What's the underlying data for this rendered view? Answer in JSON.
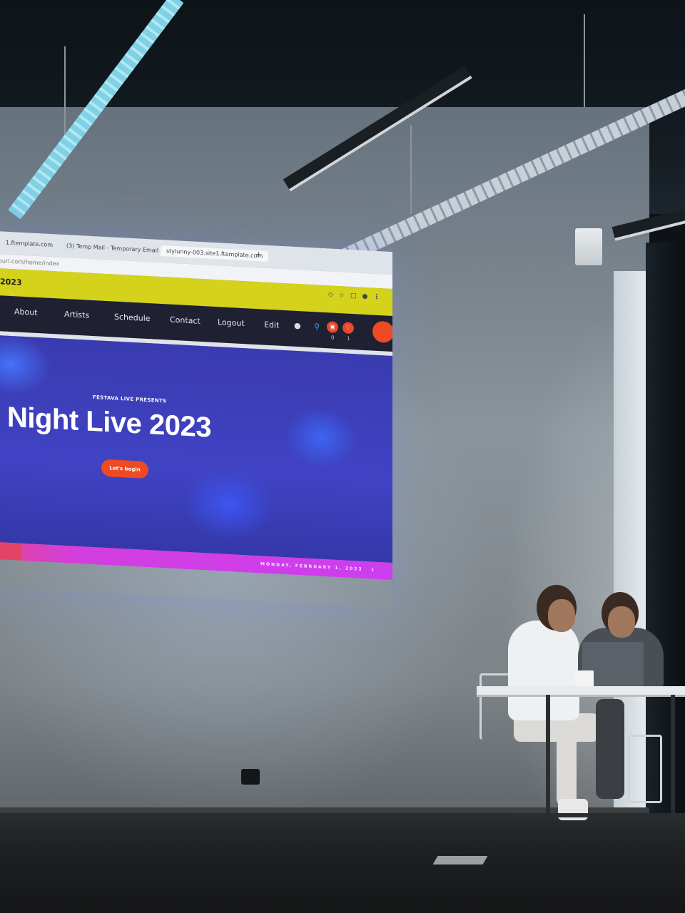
{
  "projection": {
    "tabs": [
      "1.ftemplate.com",
      "(3) Temp Mail - Temporary Email",
      "stylunny-003.site1.ftemplate.com"
    ],
    "tab_new": "+",
    "url": "ourl.com/home/index",
    "brand": "2023",
    "nav": {
      "items": [
        "About",
        "Artists",
        "Schedule",
        "Contact",
        "Logout",
        "Edit"
      ],
      "cart_count": "0",
      "wishlist_count": "1"
    },
    "hero": {
      "eyebrow": "FESTAVA LIVE PRESENTS",
      "title": "Night Live 2023",
      "button": "Let's begin"
    },
    "footer_bar": {
      "date": "MONDAY, FEBRUARY 1, 2023",
      "number": "1"
    }
  },
  "colors": {
    "nav_bg": "#1f2031",
    "title_bar": "#d4d21a",
    "hero_bg": "#4043c4",
    "accent": "#ee4a23",
    "date_bar": "#cc3ef0"
  },
  "icons": [
    "user-icon",
    "search-icon",
    "cart-icon",
    "heart-icon"
  ]
}
